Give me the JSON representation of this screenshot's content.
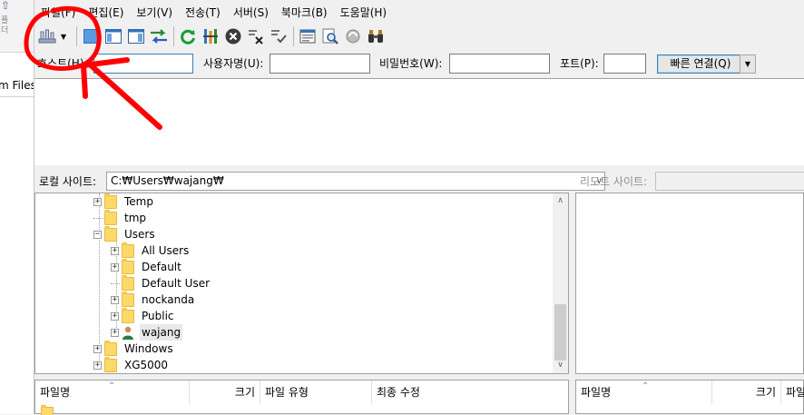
{
  "left_window": {
    "small_text": "폴\n더",
    "fragment": "m Files"
  },
  "menu": [
    "파일(F)",
    "편집(E)",
    "보기(V)",
    "전송(T)",
    "서버(S)",
    "북마크(B)",
    "도움말(H)"
  ],
  "toolbar": {
    "icons": [
      "site-manager-icon",
      "toggle-log-icon",
      "toggle-local-tree-icon",
      "toggle-remote-tree-icon",
      "toggle-queue-icon",
      "refresh-icon",
      "process-queue-icon",
      "cancel-icon",
      "disconnect-icon",
      "reconnect-icon",
      "filename-filter-icon",
      "search-files-icon",
      "sync-browse-icon",
      "find-icon"
    ]
  },
  "quickconnect": {
    "host_label": "호스트(H):",
    "host_value": "",
    "user_label": "사용자명(U):",
    "user_value": "",
    "pass_label": "비밀번호(W):",
    "pass_value": "",
    "port_label": "포트(P):",
    "port_value": "",
    "connect_label": "빠른 연결(Q)"
  },
  "local_site": {
    "label": "로컬 사이트:",
    "path": "C:₩Users₩wajang₩"
  },
  "tree": [
    {
      "label": "Temp",
      "level": 0,
      "expander": "+"
    },
    {
      "label": "tmp",
      "level": 0,
      "expander": ""
    },
    {
      "label": "Users",
      "level": 0,
      "expander": "-"
    },
    {
      "label": "All Users",
      "level": 1,
      "expander": "+"
    },
    {
      "label": "Default",
      "level": 1,
      "expander": "+"
    },
    {
      "label": "Default User",
      "level": 1,
      "expander": ""
    },
    {
      "label": "nockanda",
      "level": 1,
      "expander": "+"
    },
    {
      "label": "Public",
      "level": 1,
      "expander": "+"
    },
    {
      "label": "wajang",
      "level": 1,
      "expander": "+",
      "user": true,
      "selected": true
    },
    {
      "label": "Windows",
      "level": 0,
      "expander": "+"
    },
    {
      "label": "XG5000",
      "level": 0,
      "expander": "+"
    }
  ],
  "remote_site": {
    "label": "리모트 사이트:"
  },
  "local_columns": [
    "파일명",
    "크기",
    "파일 유형",
    "최종 수정"
  ],
  "remote_columns": [
    "파일명",
    "크기",
    "파일"
  ],
  "colors": {
    "annotation": "#ff0000",
    "folder": "#fdd969",
    "accent": "#3c7fb1"
  }
}
